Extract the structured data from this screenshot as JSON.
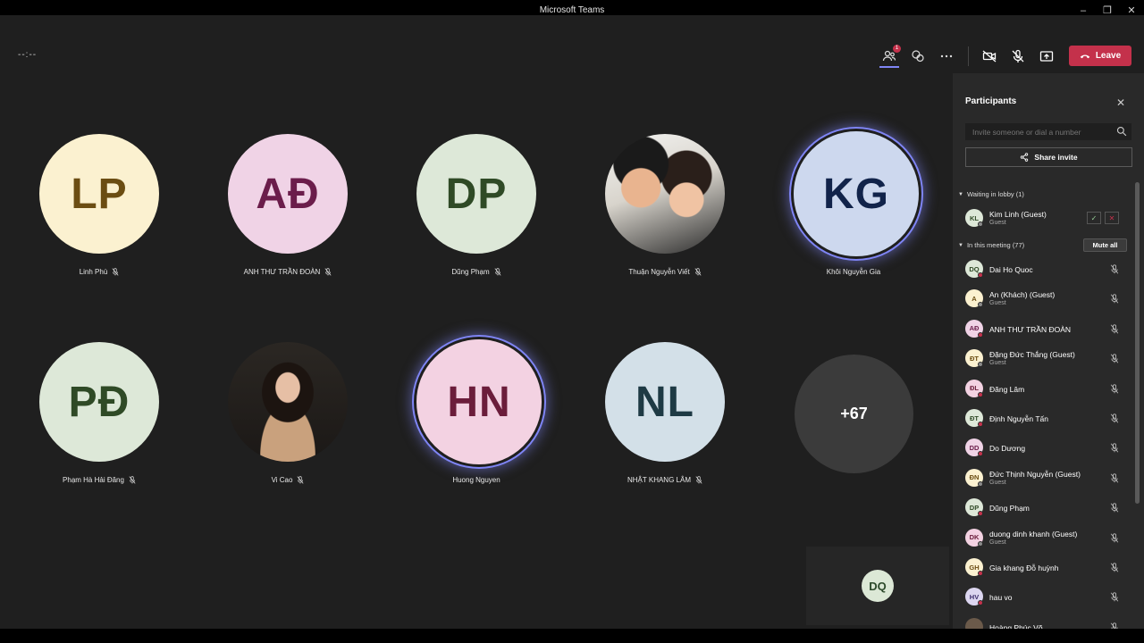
{
  "window": {
    "title": "Microsoft Teams",
    "minimize": "–",
    "maximize": "❐",
    "close": "✕"
  },
  "toolbar": {
    "timer": "--:--",
    "participants_badge": "1",
    "leave_label": "Leave",
    "colors": {
      "leave": "#c4314b",
      "accent": "#7f85f5"
    },
    "icons": [
      "participants-icon",
      "chat-icon",
      "more-options-icon",
      "camera-off-icon",
      "mic-off-icon",
      "share-screen-icon",
      "phone-hangup-icon"
    ]
  },
  "stage": {
    "tiles": [
      {
        "initials": "LP",
        "name": "Linh Phù",
        "bg": "#fbf1d0",
        "fg": "#6b4d12",
        "muted": true
      },
      {
        "initials": "AĐ",
        "name": "ANH THƯ TRẦN ĐOÀN",
        "bg": "#f0d3e6",
        "fg": "#6b1d4b",
        "muted": true
      },
      {
        "initials": "DP",
        "name": "Dũng Phạm",
        "bg": "#dde8d8",
        "fg": "#2f4a26",
        "muted": true
      },
      {
        "initials": "",
        "name": "Thuận Nguyễn Viết",
        "photo": true,
        "muted": true
      },
      {
        "initials": "KG",
        "name": "Khôi Nguyễn Gia",
        "bg": "#cdd8ee",
        "fg": "#11234a",
        "speaking": true
      },
      {
        "initials": "PĐ",
        "name": "Phạm Hà Hải Đăng",
        "bg": "#dde8d8",
        "fg": "#2f4a26",
        "muted": true
      },
      {
        "initials": "",
        "name": "Vi Cao",
        "photo": true,
        "muted": true
      },
      {
        "initials": "HN",
        "name": "Huong Nguyen",
        "bg": "#f3d2e2",
        "fg": "#6b1d3b",
        "speaking": true
      },
      {
        "initials": "NL",
        "name": "NHẬT KHANG LÂM",
        "bg": "#d3e0e8",
        "fg": "#1e3a44",
        "muted": true
      }
    ],
    "overflow_count": "+67",
    "self_initials": "DQ"
  },
  "panel": {
    "title": "Participants",
    "invite_placeholder": "Invite someone or dial a number",
    "share_invite": "Share invite",
    "lobby_header": "Waiting in lobby (1)",
    "meeting_header": "In this meeting (77)",
    "mute_all": "Mute all",
    "lobby": [
      {
        "initials": "KL",
        "name": "Kim Linh (Guest)",
        "role": "Guest",
        "bg": "#dde8d8",
        "fg": "#2f4a26"
      }
    ],
    "participants": [
      {
        "initials": "DQ",
        "name": "Dai Ho Quoc",
        "bg": "#dde8d8",
        "fg": "#2f4a26"
      },
      {
        "initials": "A",
        "name": "An (Khách) (Guest)",
        "role": "Guest",
        "bg": "#fbf1d0",
        "fg": "#6b4d12"
      },
      {
        "initials": "AĐ",
        "name": "ANH THƯ TRẦN ĐOÀN",
        "bg": "#f0d3e6",
        "fg": "#6b1d4b"
      },
      {
        "initials": "ĐT",
        "name": "Đặng Đức Thắng (Guest)",
        "role": "Guest",
        "bg": "#fbf1d0",
        "fg": "#6b4d12"
      },
      {
        "initials": "ĐL",
        "name": "Đăng Lâm",
        "bg": "#f3d2e2",
        "fg": "#6b1d3b"
      },
      {
        "initials": "ĐT",
        "name": "Định Nguyễn Tấn",
        "bg": "#dde8d8",
        "fg": "#2f4a26"
      },
      {
        "initials": "DD",
        "name": "Do Dương",
        "bg": "#f0d3e6",
        "fg": "#6b1d4b"
      },
      {
        "initials": "ĐN",
        "name": "Đức Thịnh Nguyễn (Guest)",
        "role": "Guest",
        "bg": "#fbf1d0",
        "fg": "#6b4d12"
      },
      {
        "initials": "DP",
        "name": "Dũng Phạm",
        "bg": "#dde8d8",
        "fg": "#2f4a26"
      },
      {
        "initials": "DK",
        "name": "duong dinh khanh (Guest)",
        "role": "Guest",
        "bg": "#f3d2e2",
        "fg": "#6b1d3b"
      },
      {
        "initials": "GH",
        "name": "Gia khang Đỗ huỳnh",
        "bg": "#fbf1d0",
        "fg": "#6b4d12"
      },
      {
        "initials": "HV",
        "name": "hau vo",
        "bg": "#dcd6f0",
        "fg": "#3b2d6b"
      },
      {
        "initials": "",
        "name": "Hoàng Phúc Võ",
        "bg": "#6b5a4a",
        "fg": "#fff"
      }
    ]
  }
}
